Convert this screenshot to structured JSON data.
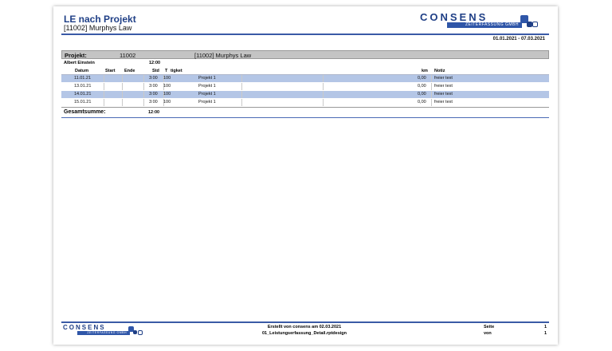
{
  "report": {
    "title": "LE nach Projekt",
    "subtitle": "[11002] Murphys Law",
    "date_range": "01.01.2021 - 07.03.2021"
  },
  "logo": {
    "name": "CONSENS",
    "tagline": "ZEITERFASSUNG GMBH"
  },
  "project": {
    "label": "Projekt:",
    "id": "11002",
    "name": "[11002] Murphys Law"
  },
  "person": {
    "name": "Albert Einstein",
    "total": "12:00"
  },
  "columns": {
    "datum": "Datum",
    "start": "Start",
    "ende": "Ende",
    "std": "Std",
    "t": "T",
    "tigket": "tigket",
    "km": "km",
    "notiz": "Notiz"
  },
  "rows": [
    {
      "datum": "11.01.21",
      "std": "3:00",
      "t": "100",
      "projekt": "Projekt 1",
      "km": "0,00",
      "notiz": "freier text",
      "highlight": true
    },
    {
      "datum": "13.01.21",
      "std": "3:00",
      "t": "100",
      "projekt": "Projekt 1",
      "km": "0,00",
      "notiz": "freier text",
      "highlight": false
    },
    {
      "datum": "14.01.21",
      "std": "3:00",
      "t": "100",
      "projekt": "Projekt 1",
      "km": "0,00",
      "notiz": "freier text",
      "highlight": true
    },
    {
      "datum": "15.01.21",
      "std": "3:00",
      "t": "100",
      "projekt": "Projekt 1",
      "km": "0,00",
      "notiz": "freier text",
      "highlight": false
    }
  ],
  "total": {
    "label": "Gesamtsumme:",
    "value": "12:00"
  },
  "footer": {
    "created": "Erstellt von consens am 02.03.2021",
    "file": "01_Leistungserfassung_Detail.rptdesign",
    "seite_label": "Seite",
    "seite_value": "1",
    "von_label": "von",
    "von_value": "1"
  },
  "colors": {
    "accent": "#2f56a8",
    "row_highlight": "#b4c6e6",
    "project_bar": "#c4c4c4"
  }
}
